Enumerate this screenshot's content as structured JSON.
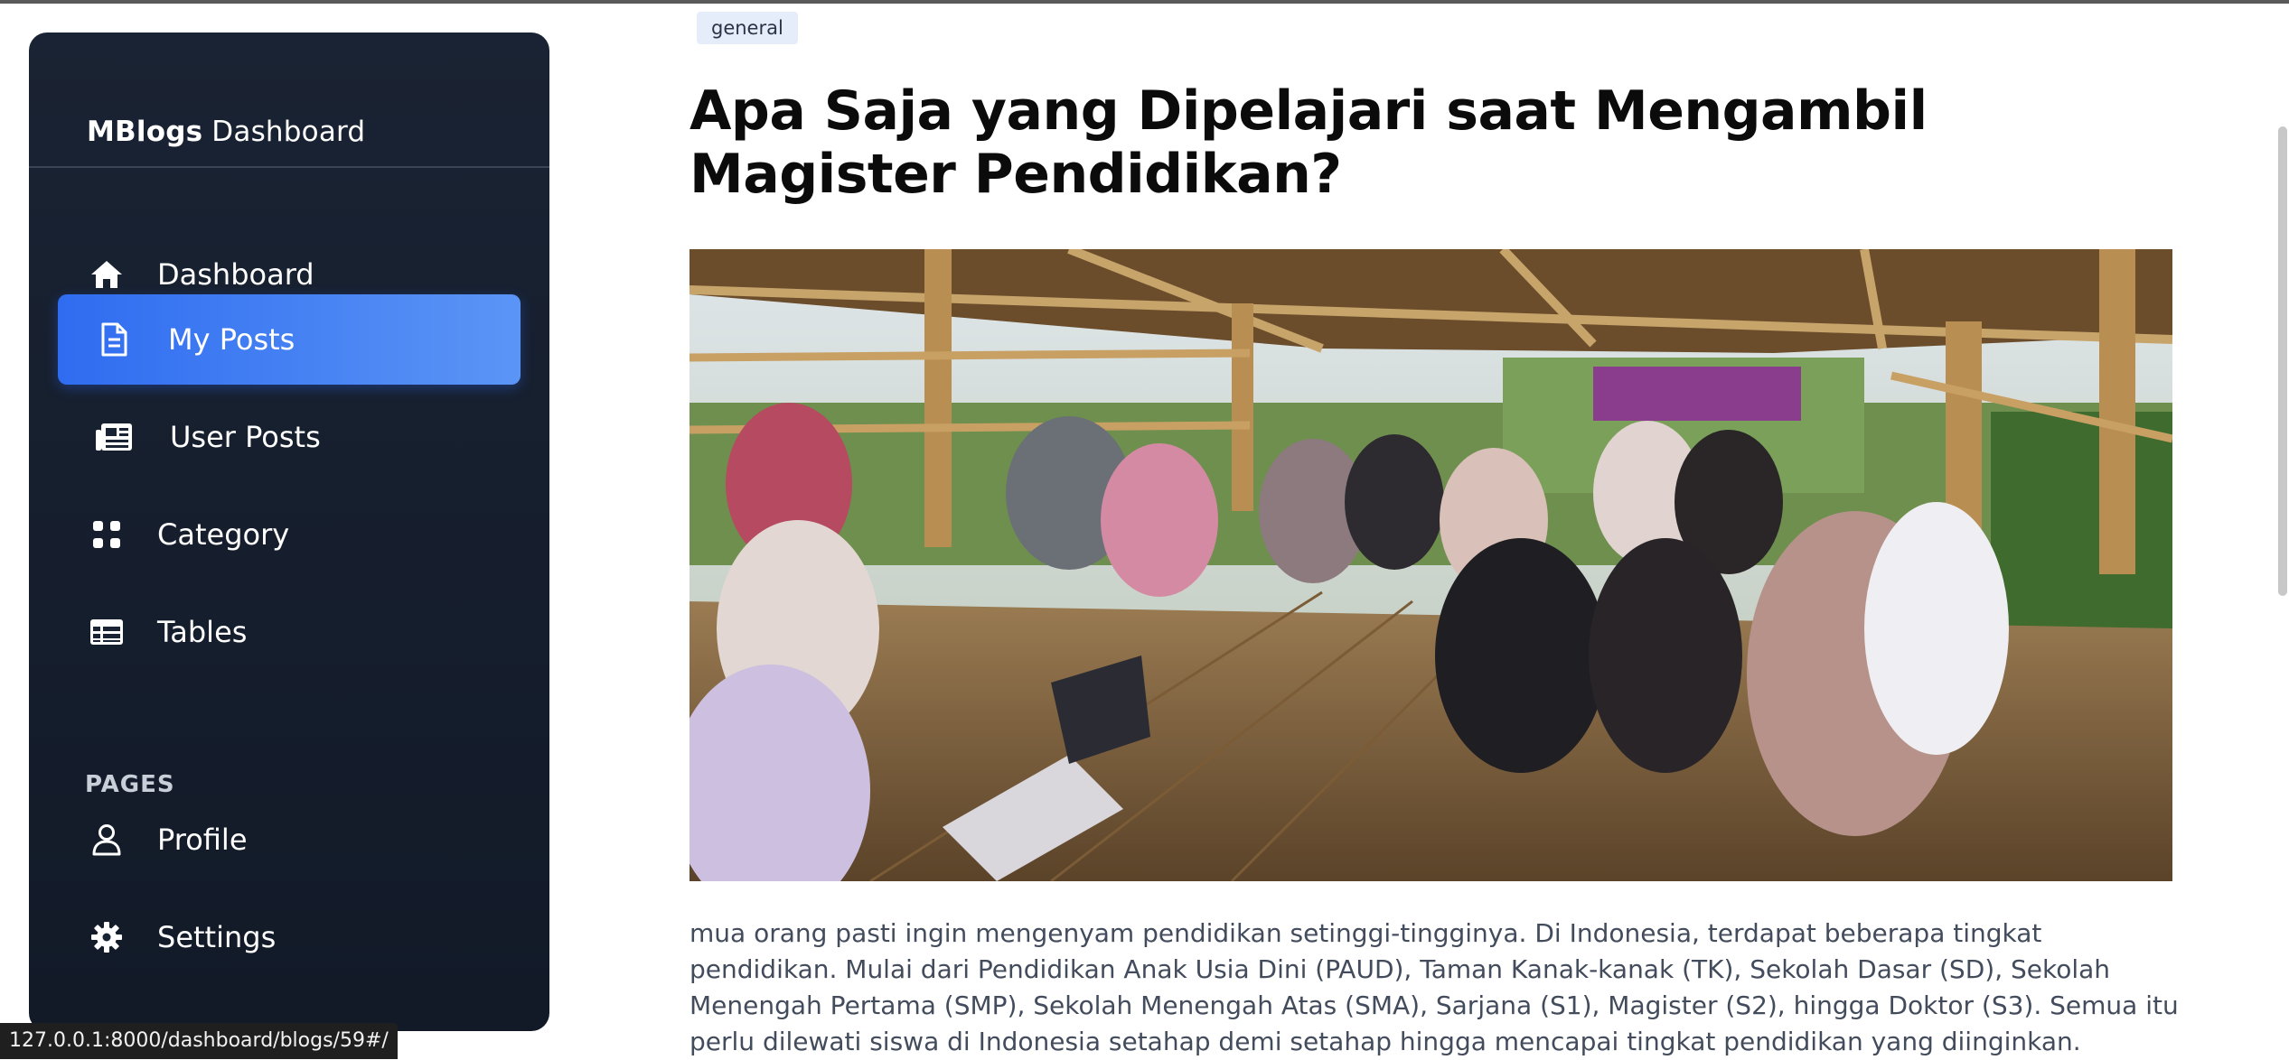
{
  "sidebar": {
    "brand_bold": "MBlogs",
    "brand_rest": " Dashboard",
    "items": [
      {
        "label": "Dashboard",
        "icon": "home-icon"
      },
      {
        "label": "My Posts",
        "icon": "document-icon",
        "active": true
      },
      {
        "label": "User Posts",
        "icon": "newspaper-icon"
      },
      {
        "label": "Category",
        "icon": "grid-icon"
      },
      {
        "label": "Tables",
        "icon": "table-icon"
      }
    ],
    "section_title": "PAGES",
    "pages": [
      {
        "label": "Profile",
        "icon": "user-icon"
      },
      {
        "label": "Settings",
        "icon": "gear-icon"
      }
    ]
  },
  "post": {
    "tag": "general",
    "title": "Apa Saja yang Dipelajari saat Mengambil Magister Pendidikan?",
    "image_icon": "photo-students-gazebo",
    "body": "mua orang pasti ingin mengenyam pendidikan setinggi-tingginya. Di Indonesia, terdapat beberapa tingkat pendidikan. Mulai dari Pendidikan Anak Usia Dini (PAUD), Taman Kanak-kanak (TK), Sekolah Dasar (SD), Sekolah Menengah Pertama (SMP), Sekolah Menengah Atas (SMA), Sarjana (S1), Magister (S2), hingga Doktor (S3). Semua itu perlu dilewati siswa di Indonesia setahap demi setahap hingga mencapai tingkat pendidikan yang diinginkan."
  },
  "status_bar": {
    "url": "127.0.0.1:8000/dashboard/blogs/59#/"
  },
  "colors": {
    "sidebar_bg": "#1a2333",
    "active_start": "#2f6cf0",
    "active_end": "#5b95f6",
    "tag_bg": "#e4edf9",
    "body_text": "#434c5c"
  }
}
